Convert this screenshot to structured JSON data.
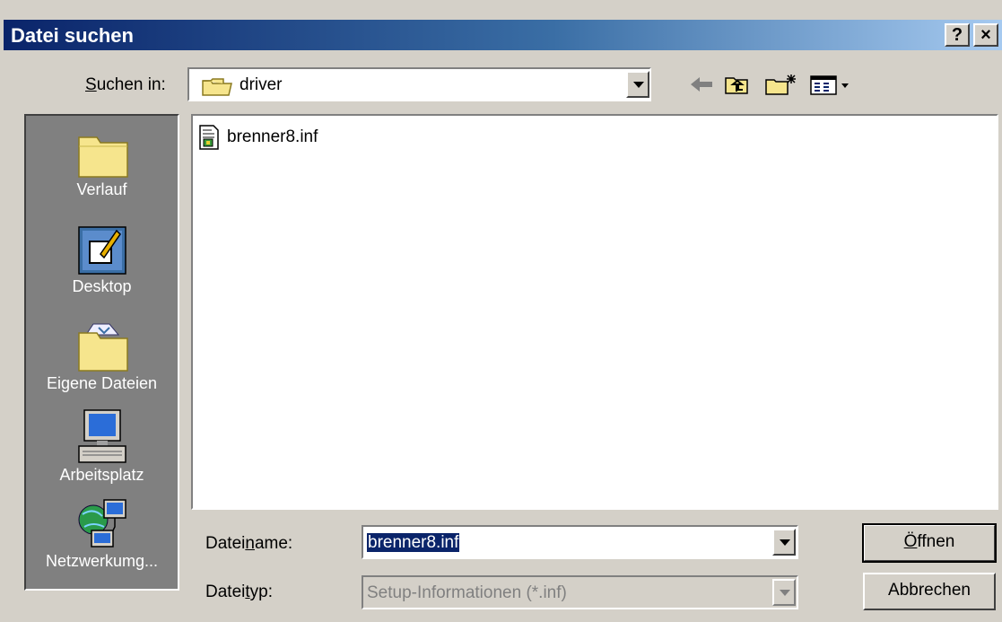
{
  "window": {
    "title": "Datei suchen",
    "help_label": "?",
    "close_label": "×"
  },
  "lookin": {
    "label_pre": "",
    "label_access": "S",
    "label_post": "uchen in:",
    "value": "driver"
  },
  "toolbar": {
    "icons": [
      "back-icon",
      "up-folder-icon",
      "new-folder-icon",
      "view-menu-icon"
    ]
  },
  "places": [
    {
      "label": "Verlauf",
      "icon": "history-icon"
    },
    {
      "label": "Desktop",
      "icon": "desktop-icon"
    },
    {
      "label": "Eigene Dateien",
      "icon": "my-documents-icon"
    },
    {
      "label": "Arbeitsplatz",
      "icon": "my-computer-icon"
    },
    {
      "label": "Netzwerkumg...",
      "icon": "network-icon"
    }
  ],
  "files": [
    {
      "name": "brenner8.inf",
      "icon": "inf-file-icon"
    }
  ],
  "filename": {
    "label_pre": "Datei",
    "label_access": "n",
    "label_post": "ame:",
    "value": "brenner8.inf"
  },
  "filetype": {
    "label_pre": "Datei",
    "label_access": "t",
    "label_post": "yp:",
    "value": "Setup-Informationen (*.inf)"
  },
  "buttons": {
    "open_access": "Ö",
    "open_rest": "ffnen",
    "cancel": "Abbrechen"
  }
}
